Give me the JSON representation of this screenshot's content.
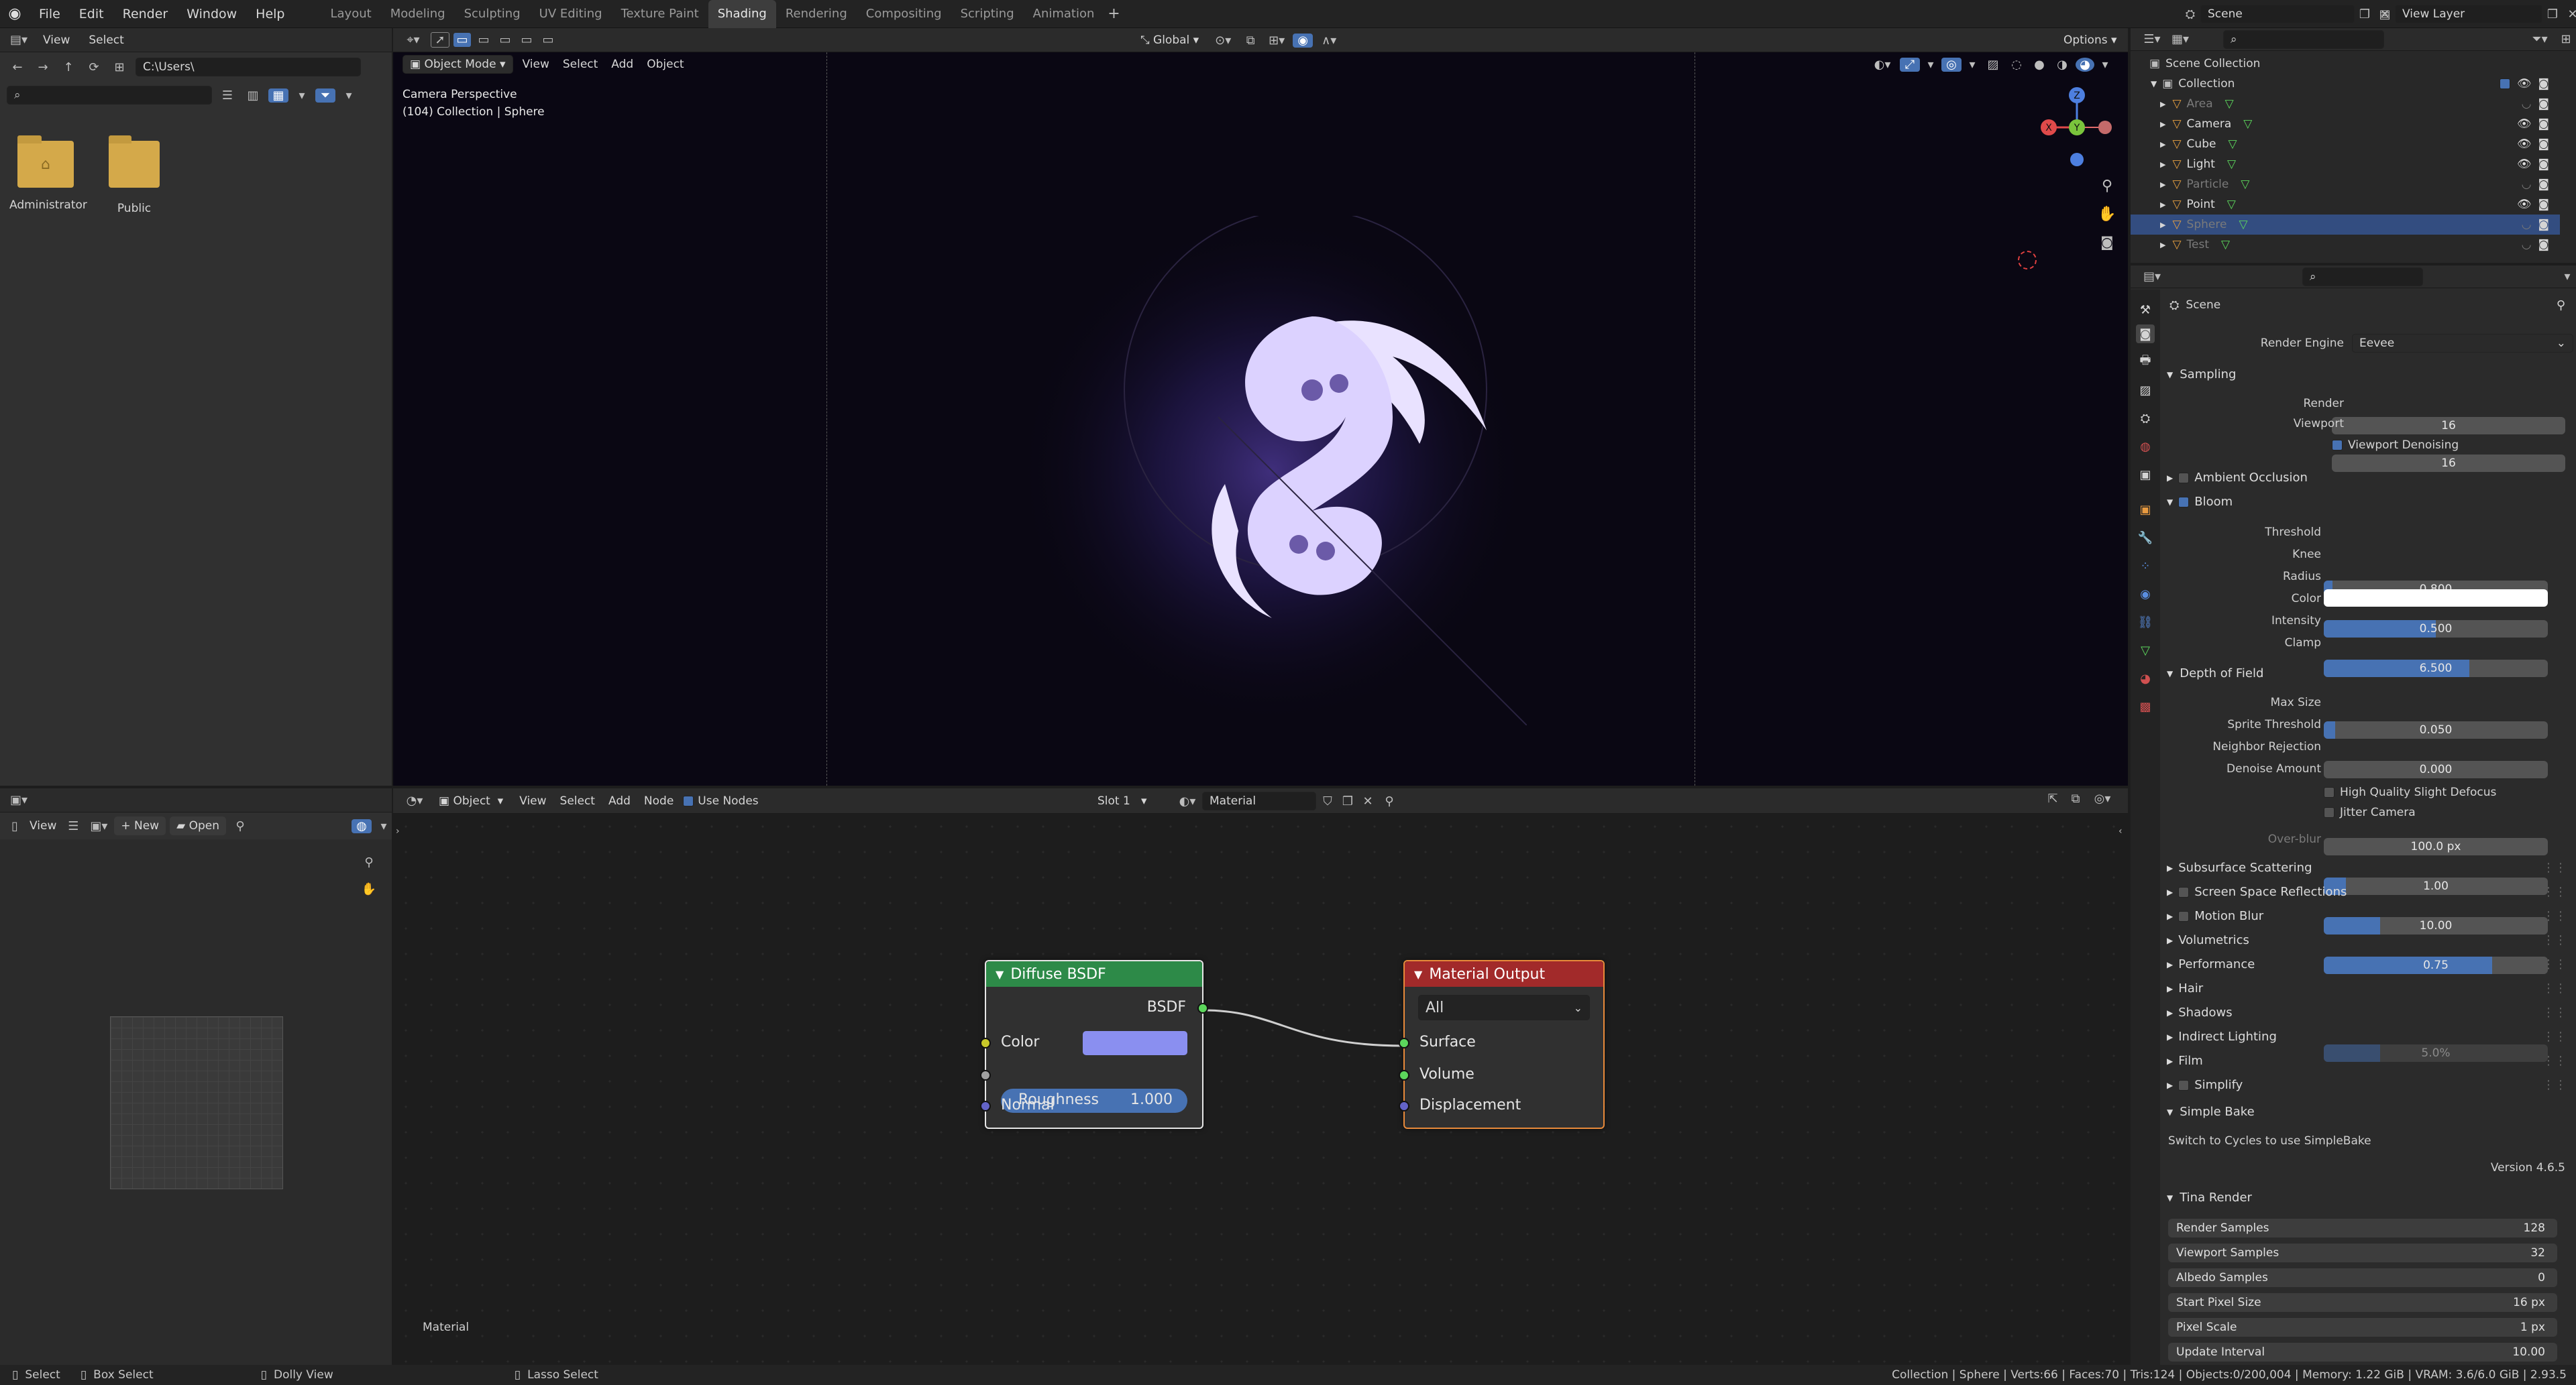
{
  "topbar": {
    "menus": [
      "File",
      "Edit",
      "Render",
      "Window",
      "Help"
    ],
    "workspaces": [
      "Layout",
      "Modeling",
      "Sculpting",
      "UV Editing",
      "Texture Paint",
      "Shading",
      "Rendering",
      "Compositing",
      "Scripting",
      "Animation"
    ],
    "active_workspace": "Shading",
    "scene_name": "Scene",
    "view_layer": "View Layer"
  },
  "file_browser": {
    "menu": [
      "View",
      "Select"
    ],
    "path": "C:\\Users\\",
    "folders": [
      "Administrator",
      "Public"
    ]
  },
  "viewport": {
    "mode": "Object Mode",
    "menus": [
      "View",
      "Select",
      "Add",
      "Object"
    ],
    "orientation": "Global",
    "options_label": "Options",
    "overlay_line1": "Camera Perspective",
    "overlay_line2": "(104) Collection | Sphere",
    "axes": {
      "z": "Z",
      "y": "Y",
      "x": "X"
    }
  },
  "image_editor": {
    "view_label": "View",
    "new_label": "New",
    "open_label": "Open"
  },
  "node_editor": {
    "object_label": "Object",
    "menus": [
      "View",
      "Select",
      "Add",
      "Node"
    ],
    "use_nodes_label": "Use Nodes",
    "slot": "Slot 1",
    "material": "Material",
    "footer_label": "Material",
    "diffuse": {
      "title": "Diffuse BSDF",
      "output": "BSDF",
      "color_label": "Color",
      "color_value": "#8a8ff0",
      "roughness_label": "Roughness",
      "roughness_value": "1.000",
      "normal_label": "Normal",
      "header_color": "#2d8a48"
    },
    "output": {
      "title": "Material Output",
      "target": "All",
      "surface": "Surface",
      "volume": "Volume",
      "displacement": "Displacement",
      "header_color": "#a22a2a"
    }
  },
  "outliner": {
    "root": "Scene Collection",
    "collection": "Collection",
    "items": [
      "Area",
      "Camera",
      "Cube",
      "Light",
      "Particle",
      "Point",
      "Sphere",
      "Test"
    ]
  },
  "properties": {
    "breadcrumb": "Scene",
    "render_engine_label": "Render Engine",
    "render_engine": "Eevee",
    "sampling": {
      "title": "Sampling",
      "render_label": "Render",
      "render_value": "16",
      "viewport_label": "Viewport",
      "viewport_value": "16",
      "denoise_label": "Viewport Denoising"
    },
    "ambient_occlusion": "Ambient Occlusion",
    "bloom": {
      "title": "Bloom",
      "threshold_label": "Threshold",
      "threshold": "0.800",
      "threshold_fill": 0.04,
      "knee_label": "Knee",
      "knee": "0.500",
      "knee_fill": 0.5,
      "radius_label": "Radius",
      "radius": "6.500",
      "radius_fill": 0.65,
      "color_label": "Color",
      "intensity_label": "Intensity",
      "intensity": "0.050",
      "intensity_fill": 0.05,
      "clamp_label": "Clamp",
      "clamp": "0.000"
    },
    "dof": {
      "title": "Depth of Field",
      "max_size_label": "Max Size",
      "max_size": "100.0 px",
      "sprite_label": "Sprite Threshold",
      "sprite": "1.00",
      "sprite_fill": 0.1,
      "neighbor_label": "Neighbor Rejection",
      "neighbor": "10.00",
      "neighbor_fill": 0.25,
      "denoise_label": "Denoise Amount",
      "denoise": "0.75",
      "denoise_fill": 0.75,
      "hq_label": "High Quality Slight Defocus",
      "jitter_label": "Jitter Camera",
      "overblur_label": "Over-blur",
      "overblur": "5.0%",
      "overblur_fill": 0.25
    },
    "sections": [
      "Subsurface Scattering",
      "Screen Space Reflections",
      "Motion Blur",
      "Volumetrics",
      "Performance",
      "Hair",
      "Shadows",
      "Indirect Lighting",
      "Film",
      "Simplify"
    ],
    "simple_bake": {
      "title": "Simple Bake",
      "note": "Switch to Cycles to use SimpleBake",
      "version": "Version 4.6.5"
    },
    "tina": {
      "title": "Tina Render",
      "rows": [
        {
          "label": "Render Samples",
          "value": "128"
        },
        {
          "label": "Viewport Samples",
          "value": "32"
        },
        {
          "label": "Albedo Samples",
          "value": "0"
        },
        {
          "label": "Start Pixel Size",
          "value": "16 px"
        },
        {
          "label": "Pixel Scale",
          "value": "1 px"
        },
        {
          "label": "Update Interval",
          "value": "10.00"
        }
      ]
    }
  },
  "statusbar": {
    "select": "Select",
    "box_select": "Box Select",
    "dolly": "Dolly View",
    "lasso": "Lasso Select",
    "stats": "Collection | Sphere | Verts:66 | Faces:70 | Tris:124 | Objects:0/200,004 | Memory: 1.22 GiB | VRAM: 3.6/6.0 GiB | 2.93.5"
  },
  "colors": {
    "accent": "#4772b3",
    "selection": "#334d80"
  }
}
